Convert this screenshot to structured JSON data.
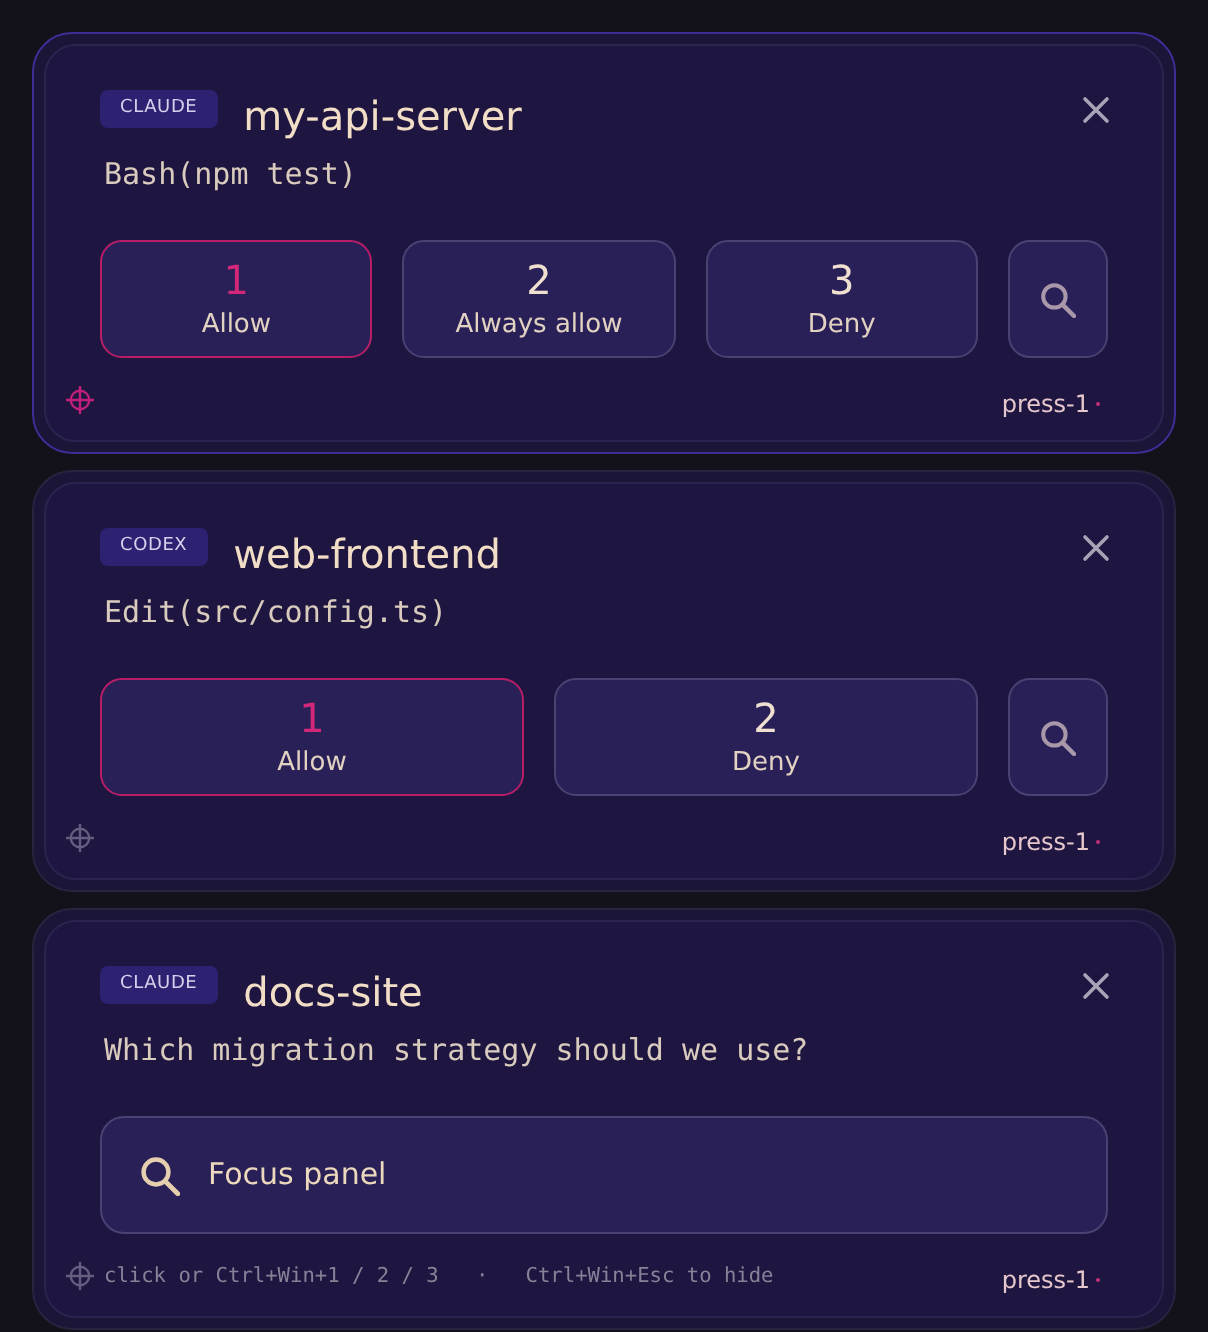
{
  "cards": [
    {
      "kind": "permission",
      "focused": true,
      "agent": "CLAUDE",
      "project": "my-api-server",
      "request": "Bash(npm test)",
      "options": [
        {
          "number": "1",
          "label": "Allow",
          "selected": true
        },
        {
          "number": "2",
          "label": "Always allow",
          "selected": false
        },
        {
          "number": "3",
          "label": "Deny",
          "selected": false
        }
      ],
      "action": "press-1"
    },
    {
      "kind": "permission",
      "focused": false,
      "agent": "CODEX",
      "project": "web-frontend",
      "request": "Edit(src/config.ts)",
      "options": [
        {
          "number": "1",
          "label": "Allow",
          "selected": true
        },
        {
          "number": "2",
          "label": "Deny",
          "selected": false
        }
      ],
      "action": "press-1"
    },
    {
      "kind": "question",
      "focused": false,
      "agent": "CLAUDE",
      "project": "docs-site",
      "request": "Which migration strategy should we use?",
      "focus_button": "Focus panel",
      "hint": "click or Ctrl+Win+1 / 2 / 3   ·   Ctrl+Win+Esc to hide",
      "action": "press-1"
    }
  ]
}
